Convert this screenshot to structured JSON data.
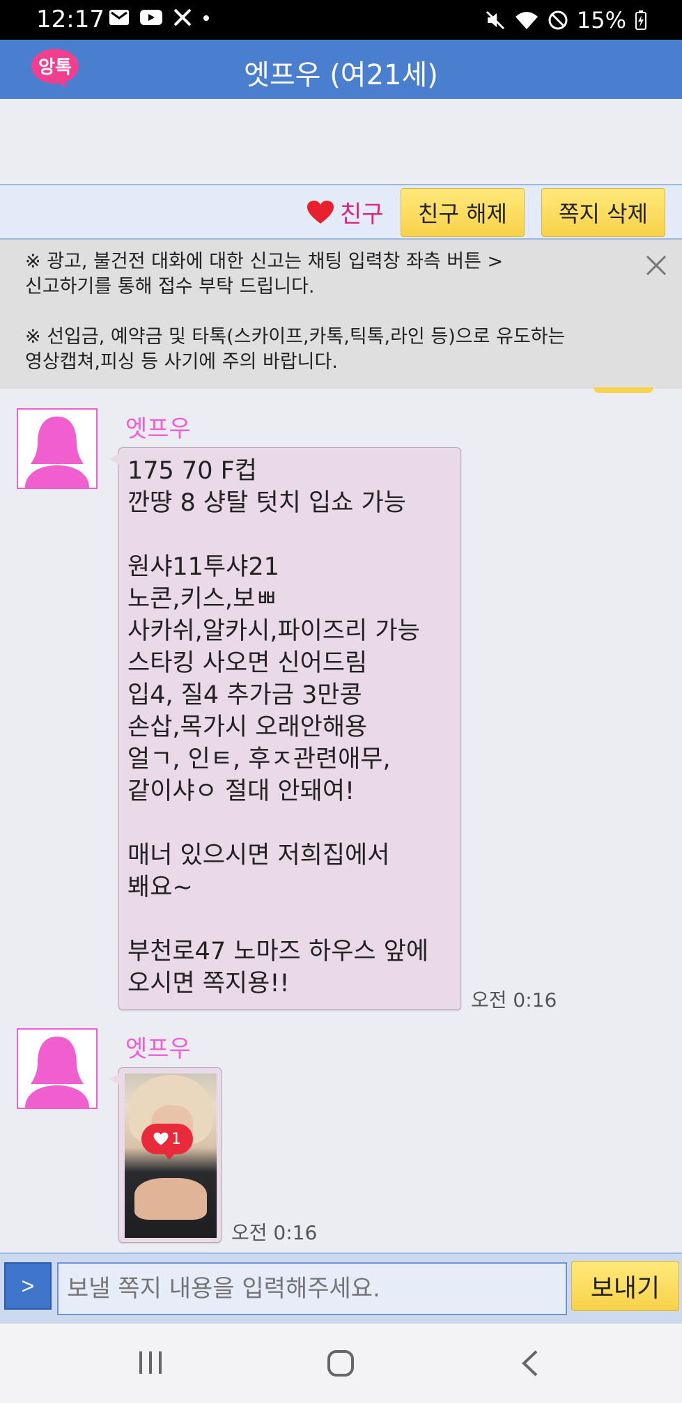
{
  "status_bar": {
    "time": "12:17",
    "battery": "15%",
    "left_icons": [
      "mail-icon",
      "youtube-icon",
      "x-icon",
      "dot-icon"
    ],
    "right_icons": [
      "mute-icon",
      "wifi-icon",
      "block-icon",
      "battery-icon"
    ]
  },
  "header": {
    "logo_text": "앙톡",
    "title": "엣프우 (여21세)"
  },
  "friend_bar": {
    "friend_label": "친구",
    "unfriend_button": "친구 해제",
    "delete_button": "쪽지 삭제"
  },
  "notice": {
    "line1": "※ 광고, 불건전 대화에 대한 신고는 채팅 입력창 좌측 버튼 >",
    "line2": "신고하기를 통해 접수 부탁 드립니다.",
    "line3": "※ 선입금, 예약금 및 타톡(스카이프,카톡,틱톡,라인 등)으로 유도하는",
    "line4": "영상캡쳐,피싱 등 사기에 주의 바랍니다."
  },
  "messages": [
    {
      "sender": "엣프우",
      "text": "175 70 F컵\n깐땽 8 샹탈 텃치 입쇼 가능\n\n원샤11투샤21\n노콘,키스,보ㅃ\n사카쉬,알카시,파이즈리 가능\n스타킹 사오면 신어드림\n입4, 질4 추가금 3만콩\n손삽,목가시 오래안해용\n얼ㄱ, 인ㅌ, 후ㅈ관련애무,\n같이샤ㅇ 절대 안돼여!\n\n매너 있으시면 저희집에서\n봬요~\n\n부천로47 노마즈 하우스 앞에\n오시면 쪽지용!!",
      "time": "오전 0:16"
    },
    {
      "sender": "엣프우",
      "like_count": "1",
      "time": "오전 0:16"
    }
  ],
  "input_bar": {
    "report_button": ">",
    "placeholder": "보낼 쪽지 내용을 입력해주세요.",
    "send_button": "보내기"
  },
  "colors": {
    "header": "#4a7fd0",
    "accent_pink": "#f05ed0",
    "button_yellow": "#f8d24a",
    "bubble": "#ead9e6"
  }
}
